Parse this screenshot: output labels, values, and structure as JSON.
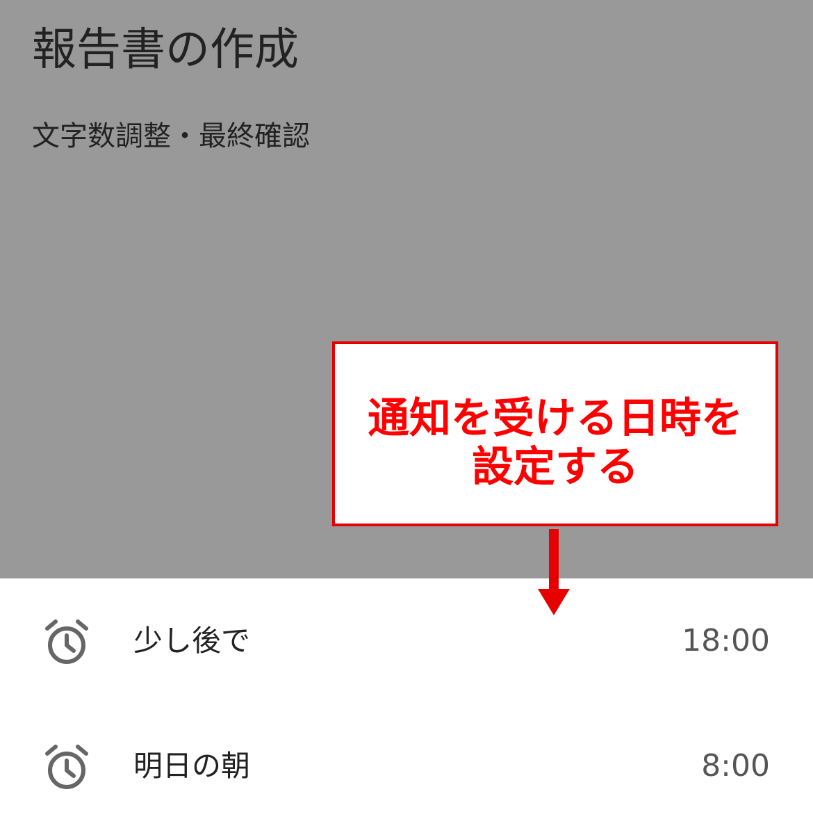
{
  "task": {
    "title": "報告書の作成",
    "subtitle": "文字数調整・最終確認"
  },
  "reminder_options": [
    {
      "label": "少し後で",
      "time": "18:00",
      "icon": "alarm-clock-icon"
    },
    {
      "label": "明日の朝",
      "time": "8:00",
      "icon": "alarm-clock-icon"
    }
  ],
  "annotation": {
    "line1": "通知を受ける日時を",
    "line2": "設定する",
    "color": "#ff0000"
  },
  "colors": {
    "overlay": "#999999",
    "sheet": "#ffffff",
    "accent": "#e60000"
  }
}
